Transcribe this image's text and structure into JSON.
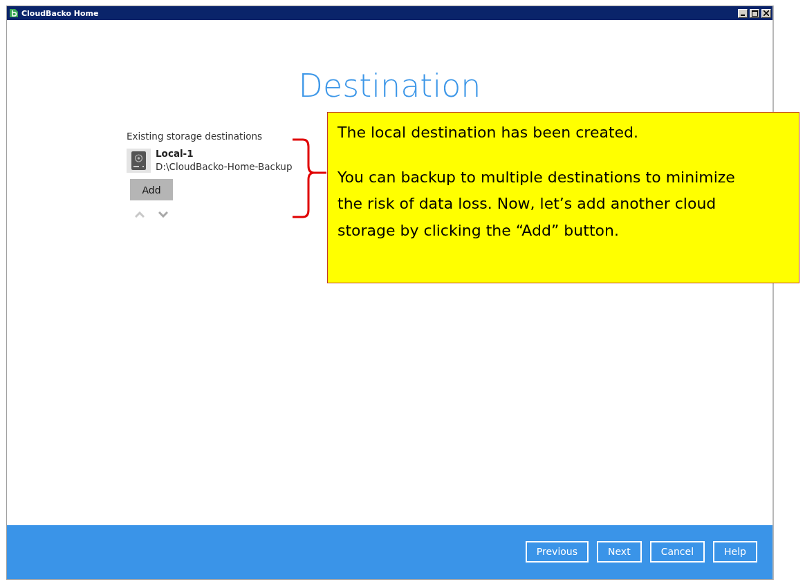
{
  "window": {
    "title": "CloudBacko Home"
  },
  "heading": "Destination",
  "storage": {
    "label": "Existing storage destinations",
    "destinations": [
      {
        "name": "Local-1",
        "path": "D:\\CloudBacko-Home-Backup"
      }
    ],
    "add_button": "Add"
  },
  "footer": {
    "buttons": [
      "Previous",
      "Next",
      "Cancel",
      "Help"
    ]
  },
  "callout": {
    "paragraphs": [
      "The local destination has been created.",
      "You can backup to multiple destinations to minimize the risk of data loss. Now, let’s add another cloud storage  by clicking the “Add” button."
    ]
  }
}
